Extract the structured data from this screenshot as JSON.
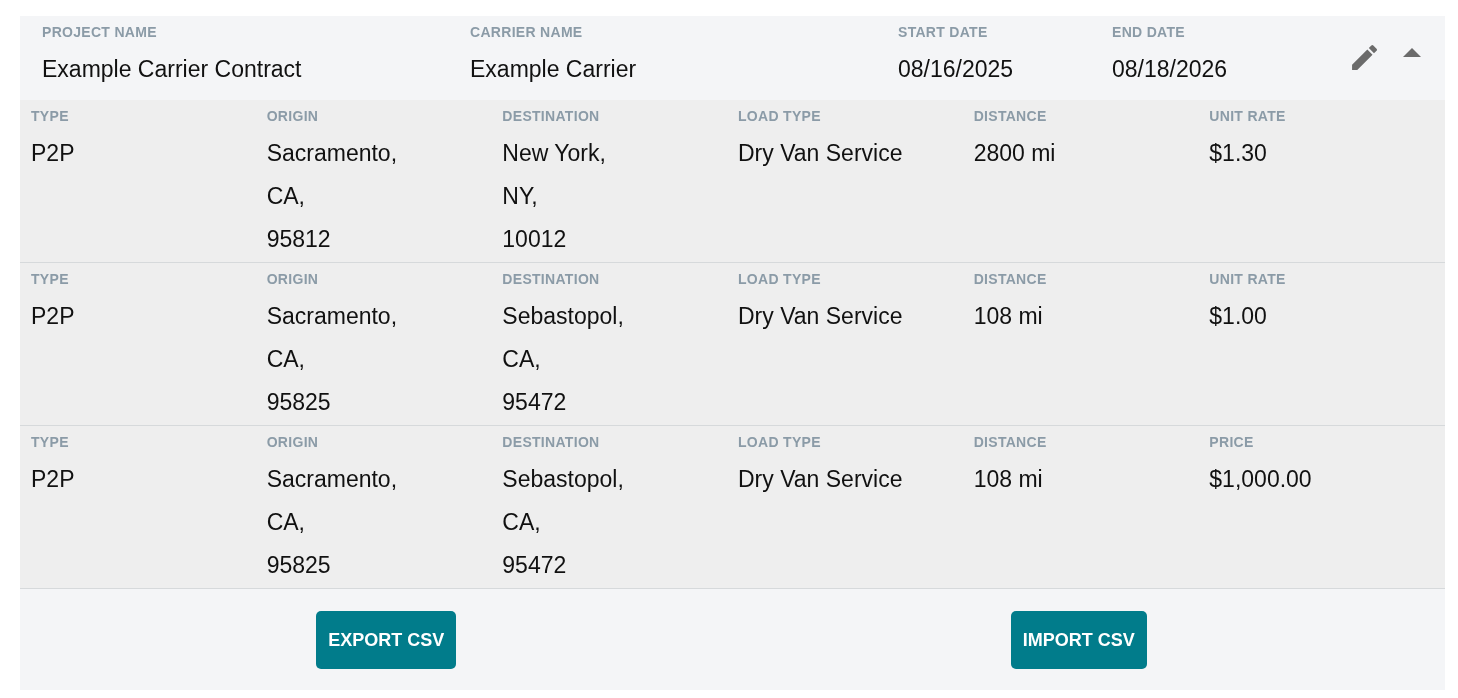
{
  "header": {
    "expanded": true,
    "fields": [
      {
        "label": "PROJECT NAME",
        "value": "Example Carrier Contract"
      },
      {
        "label": "CARRIER NAME",
        "value": "Example Carrier"
      },
      {
        "label": "START DATE",
        "value": "08/16/2025"
      },
      {
        "label": "END DATE",
        "value": "08/18/2026"
      }
    ]
  },
  "rows": [
    {
      "fields": [
        {
          "label": "TYPE",
          "value": "P2P"
        },
        {
          "label": "ORIGIN",
          "value": "Sacramento,\nCA,\n95812"
        },
        {
          "label": "DESTINATION",
          "value": "New York,\nNY,\n10012"
        },
        {
          "label": "LOAD TYPE",
          "value": "Dry Van Service"
        },
        {
          "label": "DISTANCE",
          "value": "2800 mi"
        },
        {
          "label": "UNIT RATE",
          "value": "$1.30"
        }
      ]
    },
    {
      "fields": [
        {
          "label": "TYPE",
          "value": "P2P"
        },
        {
          "label": "ORIGIN",
          "value": "Sacramento,\nCA,\n95825"
        },
        {
          "label": "DESTINATION",
          "value": "Sebastopol,\nCA,\n95472"
        },
        {
          "label": "LOAD TYPE",
          "value": "Dry Van Service"
        },
        {
          "label": "DISTANCE",
          "value": "108 mi"
        },
        {
          "label": "UNIT RATE",
          "value": "$1.00"
        }
      ]
    },
    {
      "fields": [
        {
          "label": "TYPE",
          "value": "P2P"
        },
        {
          "label": "ORIGIN",
          "value": "Sacramento,\nCA,\n95825"
        },
        {
          "label": "DESTINATION",
          "value": "Sebastopol,\nCA,\n95472"
        },
        {
          "label": "LOAD TYPE",
          "value": "Dry Van Service"
        },
        {
          "label": "DISTANCE",
          "value": "108 mi"
        },
        {
          "label": "PRICE",
          "value": "$1,000.00"
        }
      ]
    }
  ],
  "buttons": [
    "EXPORT CSV",
    "IMPORT CSV"
  ]
}
